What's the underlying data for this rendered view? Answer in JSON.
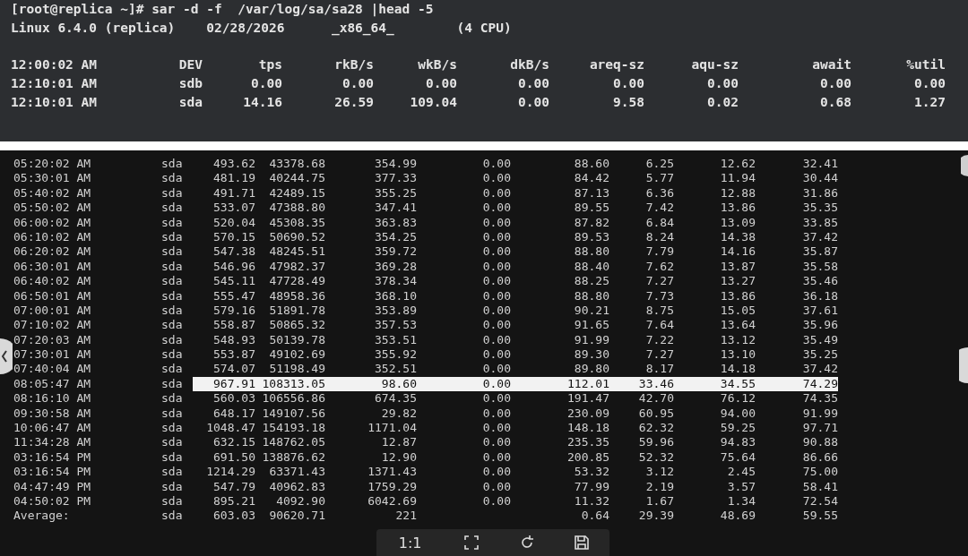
{
  "top_terminal": {
    "command_line": "[root@replica ~]# sar -d -f  /var/log/sa/sa28 |head -5",
    "system_line": "Linux 6.4.0 (replica)    02/28/2026      _x86_64_        (4 CPU)",
    "header": [
      "12:00:02 AM",
      "DEV",
      "tps",
      "rkB/s",
      "wkB/s",
      "dkB/s",
      "areq-sz",
      "aqu-sz",
      "await",
      "%util"
    ],
    "rows": [
      [
        "12:10:01 AM",
        "sdb",
        "0.00",
        "0.00",
        "0.00",
        "0.00",
        "0.00",
        "0.00",
        "0.00",
        "0.00"
      ],
      [
        "12:10:01 AM",
        "sda",
        "14.16",
        "26.59",
        "109.04",
        "0.00",
        "9.58",
        "0.02",
        "0.68",
        "1.27"
      ]
    ]
  },
  "bottom_terminal": {
    "rows": [
      {
        "selected": false,
        "cells": [
          "05:20:02 AM",
          "sda",
          "493.62",
          "43378.68",
          "354.99",
          "0.00",
          "88.60",
          "6.25",
          "12.62",
          "32.41"
        ]
      },
      {
        "selected": false,
        "cells": [
          "05:30:01 AM",
          "sda",
          "481.19",
          "40244.75",
          "377.33",
          "0.00",
          "84.42",
          "5.77",
          "11.94",
          "30.44"
        ]
      },
      {
        "selected": false,
        "cells": [
          "05:40:02 AM",
          "sda",
          "491.71",
          "42489.15",
          "355.25",
          "0.00",
          "87.13",
          "6.36",
          "12.88",
          "31.86"
        ]
      },
      {
        "selected": false,
        "cells": [
          "05:50:02 AM",
          "sda",
          "533.07",
          "47388.80",
          "347.41",
          "0.00",
          "89.55",
          "7.42",
          "13.86",
          "35.35"
        ]
      },
      {
        "selected": false,
        "cells": [
          "06:00:02 AM",
          "sda",
          "520.04",
          "45308.35",
          "363.83",
          "0.00",
          "87.82",
          "6.84",
          "13.09",
          "33.85"
        ]
      },
      {
        "selected": false,
        "cells": [
          "06:10:02 AM",
          "sda",
          "570.15",
          "50690.52",
          "354.25",
          "0.00",
          "89.53",
          "8.24",
          "14.38",
          "37.42"
        ]
      },
      {
        "selected": false,
        "cells": [
          "06:20:02 AM",
          "sda",
          "547.38",
          "48245.51",
          "359.72",
          "0.00",
          "88.80",
          "7.79",
          "14.16",
          "35.87"
        ]
      },
      {
        "selected": false,
        "cells": [
          "06:30:01 AM",
          "sda",
          "546.96",
          "47982.37",
          "369.28",
          "0.00",
          "88.40",
          "7.62",
          "13.87",
          "35.58"
        ]
      },
      {
        "selected": false,
        "cells": [
          "06:40:02 AM",
          "sda",
          "545.11",
          "47728.49",
          "378.34",
          "0.00",
          "88.25",
          "7.27",
          "13.27",
          "35.46"
        ]
      },
      {
        "selected": false,
        "cells": [
          "06:50:01 AM",
          "sda",
          "555.47",
          "48958.36",
          "368.10",
          "0.00",
          "88.80",
          "7.73",
          "13.86",
          "36.18"
        ]
      },
      {
        "selected": false,
        "cells": [
          "07:00:01 AM",
          "sda",
          "579.16",
          "51891.78",
          "353.89",
          "0.00",
          "90.21",
          "8.75",
          "15.05",
          "37.61"
        ]
      },
      {
        "selected": false,
        "cells": [
          "07:10:02 AM",
          "sda",
          "558.87",
          "50865.32",
          "357.53",
          "0.00",
          "91.65",
          "7.64",
          "13.64",
          "35.96"
        ]
      },
      {
        "selected": false,
        "cells": [
          "07:20:03 AM",
          "sda",
          "548.93",
          "50139.78",
          "353.51",
          "0.00",
          "91.99",
          "7.22",
          "13.12",
          "35.49"
        ]
      },
      {
        "selected": false,
        "cells": [
          "07:30:01 AM",
          "sda",
          "553.87",
          "49102.69",
          "355.92",
          "0.00",
          "89.30",
          "7.27",
          "13.10",
          "35.25"
        ]
      },
      {
        "selected": false,
        "cells": [
          "07:40:04 AM",
          "sda",
          "574.07",
          "51198.49",
          "352.51",
          "0.00",
          "89.80",
          "8.17",
          "14.18",
          "37.42"
        ]
      },
      {
        "selected": true,
        "cells": [
          "08:05:47 AM",
          "sda",
          "967.91",
          "108313.05",
          "98.60",
          "0.00",
          "112.01",
          "33.46",
          "34.55",
          "74.29"
        ]
      },
      {
        "selected": false,
        "cells": [
          "08:16:10 AM",
          "sda",
          "560.03",
          "106556.86",
          "674.35",
          "0.00",
          "191.47",
          "42.70",
          "76.12",
          "74.35"
        ]
      },
      {
        "selected": false,
        "cells": [
          "09:30:58 AM",
          "sda",
          "648.17",
          "149107.56",
          "29.82",
          "0.00",
          "230.09",
          "60.95",
          "94.00",
          "91.99"
        ]
      },
      {
        "selected": false,
        "cells": [
          "10:06:47 AM",
          "sda",
          "1048.47",
          "154193.18",
          "1171.04",
          "0.00",
          "148.18",
          "62.32",
          "59.25",
          "97.71"
        ]
      },
      {
        "selected": false,
        "cells": [
          "11:34:28 AM",
          "sda",
          "632.15",
          "148762.05",
          "12.87",
          "0.00",
          "235.35",
          "59.96",
          "94.83",
          "90.88"
        ]
      },
      {
        "selected": false,
        "cells": [
          "03:16:54 PM",
          "sda",
          "691.50",
          "138876.62",
          "12.90",
          "0.00",
          "200.85",
          "52.32",
          "75.64",
          "86.66"
        ]
      },
      {
        "selected": false,
        "cells": [
          "03:16:54 PM",
          "sda",
          "1214.29",
          "63371.43",
          "1371.43",
          "0.00",
          "53.32",
          "3.12",
          "2.45",
          "75.00"
        ]
      },
      {
        "selected": false,
        "cells": [
          "04:47:49 PM",
          "sda",
          "547.79",
          "40962.83",
          "1759.29",
          "0.00",
          "77.99",
          "2.19",
          "3.57",
          "58.41"
        ]
      },
      {
        "selected": false,
        "cells": [
          "04:50:02 PM",
          "sda",
          "895.21",
          "4092.90",
          "6042.69",
          "0.00",
          "11.32",
          "1.67",
          "1.34",
          "72.54"
        ]
      },
      {
        "selected": false,
        "cells": [
          "Average:",
          "sda",
          "603.03",
          "90620.71",
          "221",
          null,
          "0.64",
          "29.39",
          "48.69",
          "59.55"
        ]
      }
    ]
  },
  "viewer_toolbar": {
    "zoom_label": "1:1"
  }
}
